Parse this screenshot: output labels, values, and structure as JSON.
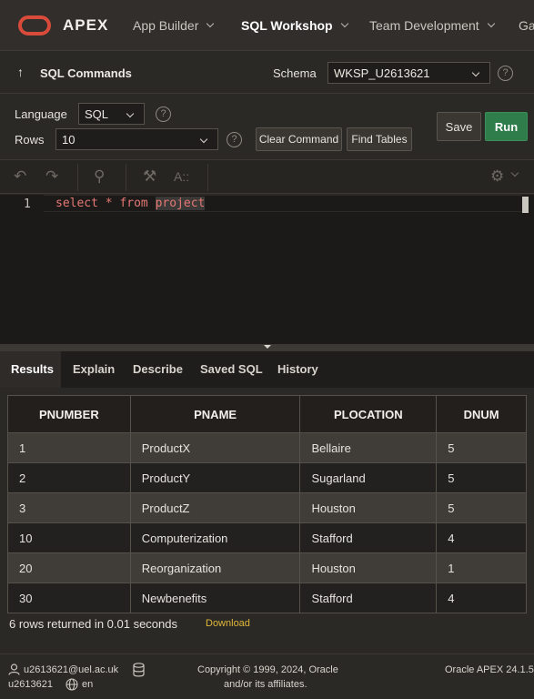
{
  "nav": {
    "brand": "APEX",
    "items": [
      {
        "label": "App Builder"
      },
      {
        "label": "SQL Workshop"
      },
      {
        "label": "Team Development"
      },
      {
        "label": "Ga"
      }
    ]
  },
  "commands": {
    "back_icon": "↑",
    "title": "SQL Commands",
    "schema_label": "Schema",
    "schema_value": "WKSP_U2613621"
  },
  "options": {
    "language_label": "Language",
    "language_value": "SQL",
    "rows_label": "Rows",
    "rows_value": "10",
    "clear_button": "Clear Command",
    "find_button": "Find Tables",
    "save_button": "Save",
    "run_button": "Run"
  },
  "editor": {
    "line_number": "1",
    "code_main": "select * from ",
    "code_highlight": "project"
  },
  "tabs": [
    "Results",
    "Explain",
    "Describe",
    "Saved SQL",
    "History"
  ],
  "results": {
    "columns": [
      "PNUMBER",
      "PNAME",
      "PLOCATION",
      "DNUM"
    ],
    "rows": [
      [
        "1",
        "ProductX",
        "Bellaire",
        "5"
      ],
      [
        "2",
        "ProductY",
        "Sugarland",
        "5"
      ],
      [
        "3",
        "ProductZ",
        "Houston",
        "5"
      ],
      [
        "10",
        "Computerization",
        "Stafford",
        "4"
      ],
      [
        "20",
        "Reorganization",
        "Houston",
        "1"
      ],
      [
        "30",
        "Newbenefits",
        "Stafford",
        "4"
      ]
    ],
    "summary": "6 rows returned in 0.01 seconds",
    "download": "Download"
  },
  "footer": {
    "email": "u2613621@uel.ac.uk",
    "username": "u2613621",
    "language": "en",
    "copyright_line1": "Copyright © 1999, 2024, Oracle",
    "copyright_line2": "and/or its affiliates.",
    "version": "Oracle APEX 24.1.5"
  },
  "colors": {
    "brand_red": "#d84b3b",
    "run_green": "#2f7d4a",
    "download_link": "#e0b73a",
    "keyword_red": "#e57873"
  }
}
